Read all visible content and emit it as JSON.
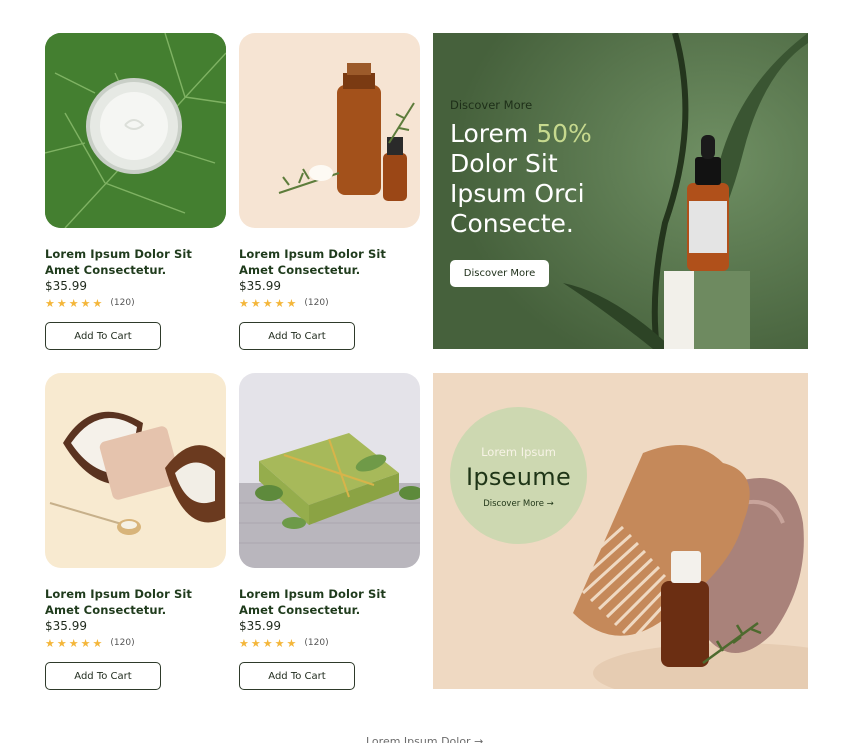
{
  "products": [
    {
      "title": "Lorem Ipsum Dolor Sit Amet Consectetur.",
      "price": "$35.99",
      "rating_count": "(120)",
      "rating": 5,
      "cart_label": "Add To Cart"
    },
    {
      "title": "Lorem Ipsum Dolor Sit Amet Consectetur.",
      "price": "$35.99",
      "rating_count": "(120)",
      "rating": 5,
      "cart_label": "Add To Cart"
    },
    {
      "title": "Lorem Ipsum Dolor Sit Amet Consectetur.",
      "price": "$35.99",
      "rating_count": "(120)",
      "rating": 5,
      "cart_label": "Add To Cart"
    },
    {
      "title": "Lorem Ipsum Dolor Sit Amet Consectetur.",
      "price": "$35.99",
      "rating_count": "(120)",
      "rating": 5,
      "cart_label": "Add To Cart"
    }
  ],
  "banner_green": {
    "kicker": "Discover More",
    "headline_part1": "Lorem ",
    "headline_accent": "50%",
    "headline_part2": "Dolor Sit Ipsum Orci Consecte.",
    "button_label": "Discover More"
  },
  "banner_beige": {
    "small_text": "Lorem Ipsum",
    "big_text": "Ipseume",
    "link_label": "Discover More →"
  },
  "footer": {
    "link_label": "Lorem Ipsum Dolor →"
  },
  "colors": {
    "star": "#f4b63a",
    "green_banner": "#5b7a52",
    "accent": "#c6d98e",
    "beige_banner": "#efd9c2",
    "circle": "#cdd8b1"
  },
  "icons": {
    "star": "star-icon",
    "arrow": "arrow-right-icon"
  }
}
